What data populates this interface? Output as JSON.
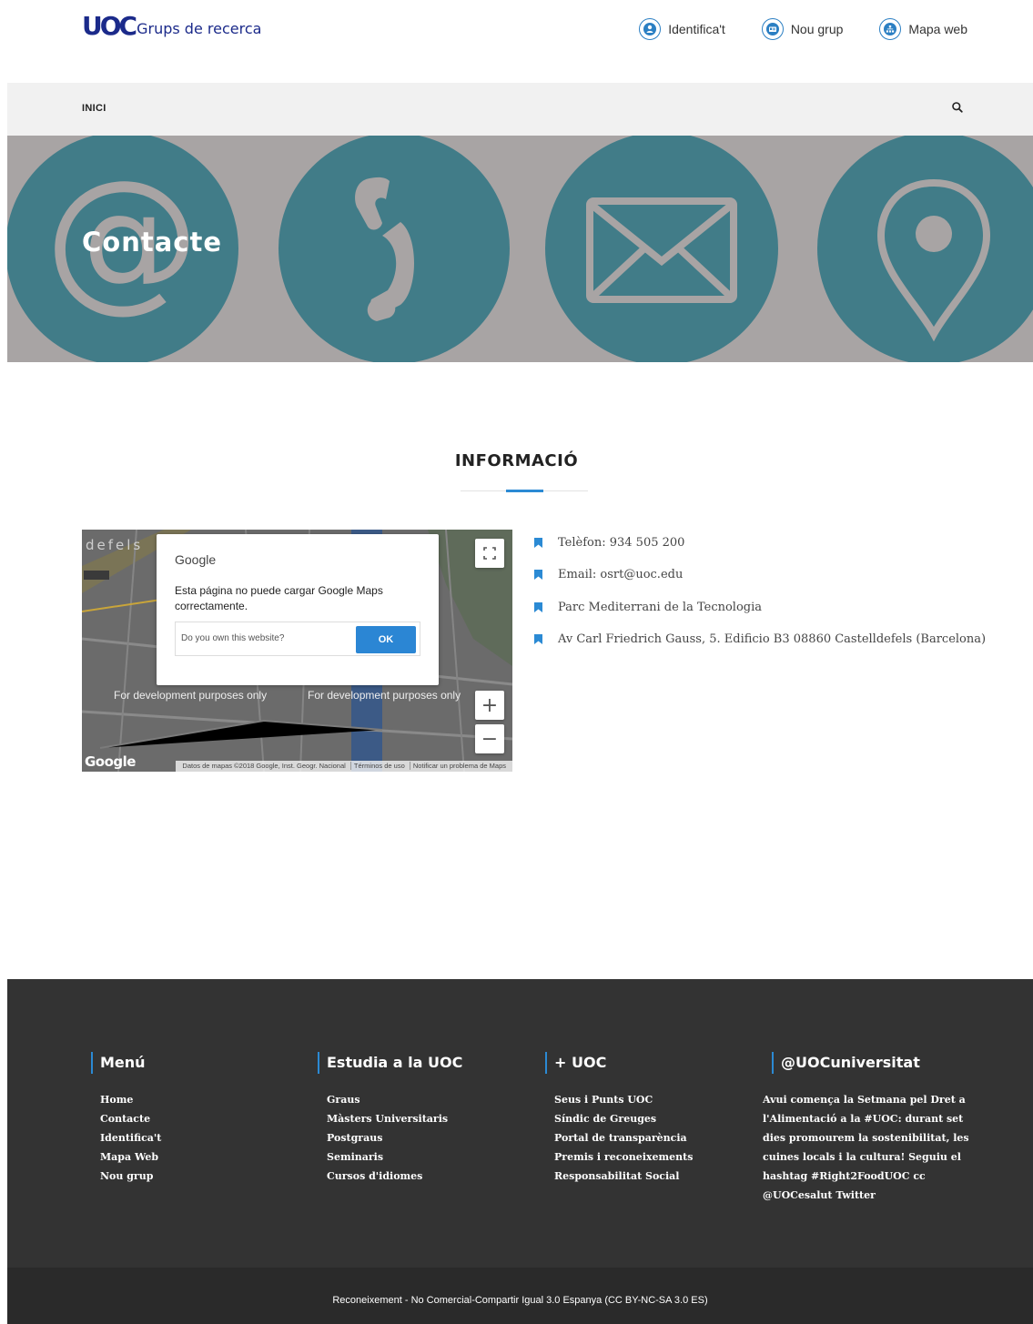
{
  "header": {
    "logo_mark": "UOC",
    "logo_text": "Grups de recerca",
    "links": [
      {
        "label": "Identifica't",
        "icon": "user-icon"
      },
      {
        "label": "Nou grup",
        "icon": "id-card-icon"
      },
      {
        "label": "Mapa web",
        "icon": "sitemap-icon"
      }
    ]
  },
  "nav": {
    "home": "INICI",
    "search_icon": "search-icon"
  },
  "hero": {
    "title": "Contacte",
    "icons": [
      "at-icon",
      "phone-icon",
      "envelope-icon",
      "location-pin-icon"
    ]
  },
  "section": {
    "title": "INFORMACIÓ"
  },
  "map": {
    "dialog_brand": "Google",
    "dialog_message": "Esta página no puede cargar Google Maps correctamente.",
    "dialog_question": "Do you own this website?",
    "dialog_ok": "OK",
    "dev_notice": "For development purposes only",
    "logo": "Google",
    "attribution": [
      "Datos de mapas ©2018 Google, Inst. Geogr. Nacional",
      "Términos de uso",
      "Notificar un problema de Maps"
    ],
    "zoom_in": "+",
    "zoom_out": "−"
  },
  "info": [
    "Telèfon: 934 505 200",
    "Email: osrt@uoc.edu",
    "Parc Mediterrani de la Tecnologia",
    "Av Carl Friedrich Gauss, 5. Edificio B3 08860 Castelldefels (Barcelona)"
  ],
  "footer": {
    "menu": {
      "title": "Menú",
      "items": [
        "Home",
        "Contacte",
        "Identifica't",
        "Mapa Web",
        "Nou grup"
      ]
    },
    "studies": {
      "title": "Estudia a la UOC",
      "items": [
        "Graus",
        "Màsters Universitaris",
        "Postgraus",
        "Seminaris",
        "Cursos d'idiomes"
      ]
    },
    "more": {
      "title": "+ UOC",
      "items": [
        "Seus i Punts UOC",
        "Síndic de Greuges",
        "Portal de transparència",
        "Premis i reconeixements",
        "Responsabilitat Social"
      ]
    },
    "twitter": {
      "title": "@UOCuniversitat",
      "text": "Avui comença la Setmana pel Dret a l'Alimentació a la #UOC: durant set dies promourem la sostenibilitat, les cuines locals i la cultura! Seguiu el hashtag #Right2FoodUOC cc @UOCesalut Twitter"
    },
    "copyright": "Reconeixement - No Comercial-Compartir Igual 3.0 Espanya (CC BY-NC-SA 3.0 ES)"
  },
  "colors": {
    "accent": "#2b8ad4",
    "teal": "#417c88",
    "hero_bg": "#a8a4a4",
    "footer_bg": "#333333"
  }
}
